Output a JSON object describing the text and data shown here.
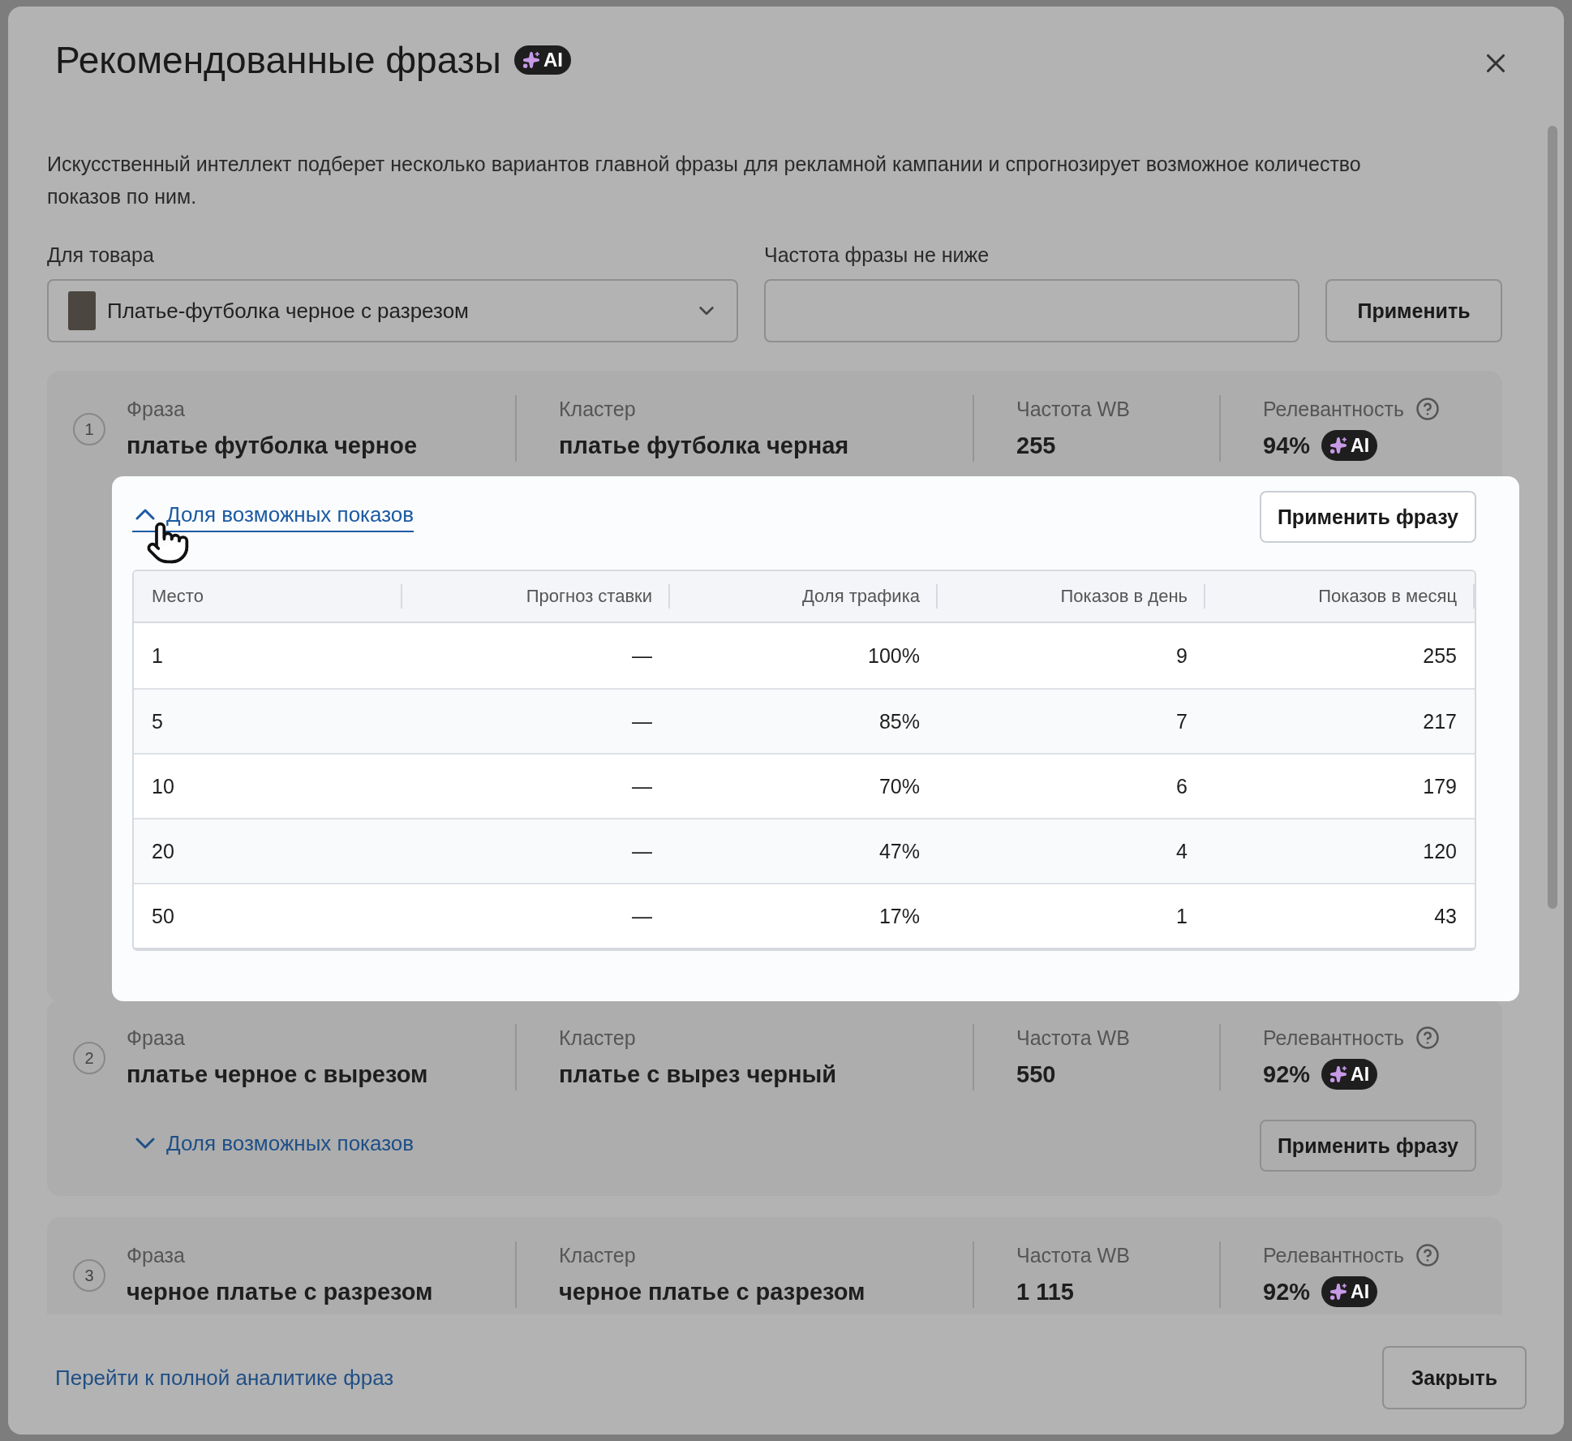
{
  "dialog": {
    "title": "Рекомендованные фразы",
    "title_badge": "AI",
    "description": "Искусственный интеллект подберет несколько вариантов главной фразы для рекламной кампании и спрогнозирует возможное количество показов по ним."
  },
  "filters": {
    "product": {
      "label": "Для товара",
      "value": "Платье-футболка черное с разрезом"
    },
    "frequency": {
      "label": "Частота фразы не ниже"
    },
    "apply_button": "Применить"
  },
  "phrases": [
    {
      "number": "1",
      "phrase_label": "Фраза",
      "phrase": "платье футболка черное",
      "cluster_label": "Кластер",
      "cluster": "платье футболка черная",
      "frequency_label": "Частота WB",
      "frequency": "255",
      "relevance_label": "Релевантность",
      "relevance": "94%",
      "relevance_badge": "AI",
      "toggle": "Доля возможных показов",
      "expanded": true,
      "spotlight": true,
      "apply_button": "Применить фразу",
      "table": {
        "columns": [
          "Место",
          "Прогноз ставки",
          "Доля трафика",
          "Показов в день",
          "Показов в месяц"
        ],
        "rows": [
          [
            "1",
            "—",
            "100%",
            "9",
            "255"
          ],
          [
            "5",
            "—",
            "85%",
            "7",
            "217"
          ],
          [
            "10",
            "—",
            "70%",
            "6",
            "179"
          ],
          [
            "20",
            "—",
            "47%",
            "4",
            "120"
          ],
          [
            "50",
            "—",
            "17%",
            "1",
            "43"
          ]
        ]
      }
    },
    {
      "number": "2",
      "phrase_label": "Фраза",
      "phrase": "платье черное с вырезом",
      "cluster_label": "Кластер",
      "cluster": "платье с вырез черный",
      "frequency_label": "Частота WB",
      "frequency": "550",
      "relevance_label": "Релевантность",
      "relevance": "92%",
      "relevance_badge": "AI",
      "toggle": "Доля возможных показов",
      "expanded": false,
      "spotlight": false,
      "apply_button": "Применить фразу"
    },
    {
      "number": "3",
      "phrase_label": "Фраза",
      "phrase": "черное платье с разрезом",
      "cluster_label": "Кластер",
      "cluster": "черное платье с разрезом",
      "frequency_label": "Частота WB",
      "frequency": "1 115",
      "relevance_label": "Релевантность",
      "relevance": "92%",
      "relevance_badge": "AI"
    }
  ],
  "footer": {
    "link": "Перейти к полной аналитике фраз",
    "close_button": "Закрыть"
  }
}
